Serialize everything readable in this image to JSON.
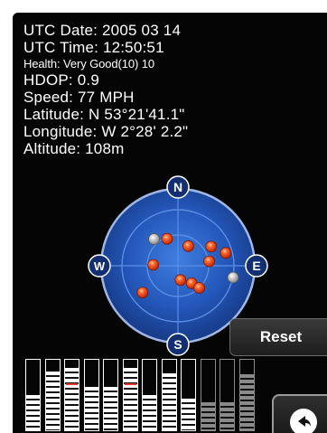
{
  "gps_info": {
    "utc_date": "UTC Date: 2005 03 14",
    "utc_time": "UTC Time:  12:50:51",
    "health": "Health: Very Good(10) 10",
    "hdop": "HDOP: 0.9",
    "speed": "Speed: 77 MPH",
    "latitude": "Latitude: N  53°21'41.1\"",
    "longitude": "Longitude: W 2°28' 2.2\"",
    "altitude": "Altitude: 108m"
  },
  "compass": {
    "north": "N",
    "south": "S",
    "east": "E",
    "west": "W"
  },
  "satellites": {
    "colors": {
      "tracked": "#e8401c",
      "untracked": "#c8c8c8"
    },
    "items": [
      {
        "az": 318,
        "el": 48,
        "status": "untracked"
      },
      {
        "az": 338,
        "el": 56,
        "status": "tracked"
      },
      {
        "az": 28,
        "el": 64,
        "status": "tracked"
      },
      {
        "az": 272,
        "el": 61,
        "status": "tracked"
      },
      {
        "az": 60,
        "el": 45,
        "status": "tracked"
      },
      {
        "az": 75,
        "el": 32,
        "status": "tracked"
      },
      {
        "az": 102,
        "el": 24,
        "status": "untracked"
      },
      {
        "az": 82,
        "el": 53,
        "status": "tracked"
      },
      {
        "az": 170,
        "el": 73,
        "status": "tracked"
      },
      {
        "az": 142,
        "el": 64,
        "status": "tracked"
      },
      {
        "az": 136,
        "el": 54,
        "status": "tracked"
      },
      {
        "az": 233,
        "el": 38,
        "status": "tracked"
      }
    ]
  },
  "signal_bars": [
    {
      "level": 0.5,
      "used": true
    },
    {
      "level": 0.85,
      "used": true
    },
    {
      "level": 0.9,
      "used": true,
      "red": true
    },
    {
      "level": 0.62,
      "used": true
    },
    {
      "level": 0.62,
      "used": true
    },
    {
      "level": 0.9,
      "used": true,
      "red": true
    },
    {
      "level": 0.5,
      "used": true
    },
    {
      "level": 0.82,
      "used": true
    },
    {
      "level": 0.45,
      "used": true
    },
    {
      "level": 0.4,
      "used": false
    },
    {
      "level": 0.4,
      "used": false
    },
    {
      "level": 0.8,
      "used": false
    }
  ],
  "buttons": {
    "reset_label": "Reset",
    "back_icon": "back-arrow-icon"
  }
}
